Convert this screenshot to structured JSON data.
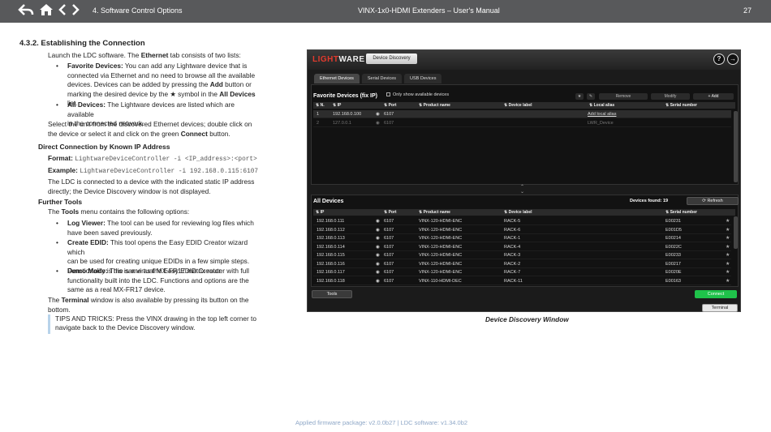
{
  "header": {
    "section": "4. Software Control Options",
    "title": "VINX-1x0-HDMI Extenders – User's Manual",
    "page_number": "27",
    "icons": [
      "back-icon",
      "home-icon",
      "prev-icon",
      "next-icon"
    ]
  },
  "content": {
    "heading": "4.3.2. Establishing the Connection",
    "intro_pre": "Launch the LDC software. The ",
    "intro_bold": "Ethernet",
    "intro_post": " tab consists of two lists:",
    "fav_label": "Favorite Devices:",
    "fav_line1": " You can add any Lightware device that is",
    "fav_line2": "connected via Ethernet and no need to browse all the available",
    "fav_line3_pre": "devices. Devices can be added by pressing the ",
    "fav_line3_bold": "Add",
    "fav_line3_post": " button or",
    "fav_line4_pre": "marking the desired device by the ★ symbol in the ",
    "fav_line4_bold": "All Devices",
    "fav_line4_post": " list.",
    "all_label": "All Devices:",
    "all_line1": " The Lightware devices are listed which are available",
    "all_line2": "in the connected network.",
    "select_line1": "Select the unit from the discovered Ethernet devices; double click on",
    "select_line2_pre": "the device or select it and click on the green ",
    "select_line2_bold": "Connect",
    "select_line2_post": " button.",
    "direct_heading": "Direct Connection by Known IP Address",
    "format_label": "Format:",
    "format_value": "LightwareDeviceController -i <IP_address>:<port>",
    "example_label": "Example:",
    "example_value": "LightwareDeviceController -i 192.168.0.115:6107",
    "ldc_line1": "The LDC is connected to a device with the indicated static IP address",
    "ldc_line2": "directly; the Device Discovery window is not displayed.",
    "further_heading": "Further Tools",
    "tools_pre": "The ",
    "tools_bold": "Tools",
    "tools_post": " menu contains the following options:",
    "log_label": "Log Viewer:",
    "log_line1": " The tool can be used for reviewing log files which",
    "log_line2": "have been saved previously.",
    "edid_label": "Create EDID:",
    "edid_line1": " This tool opens the Easy EDID Creator wizard which",
    "edid_line2": "can be used for creating unique EDIDs in a few simple steps.",
    "edid_line3": "Functionality is the same as the Easy EDID Creator.",
    "demo_label": "Demo Mode:",
    "demo_line1": " This is a virtual MX-FR17 matrix router with full",
    "demo_line2": "functionality built into the LDC. Functions and options are the",
    "demo_line3": "same as a real MX-FR17 device.",
    "term_pre": "The ",
    "term_bold": "Terminal",
    "term_post": " window is also available by pressing its button on the",
    "term_line2": "bottom.",
    "tips_line1": "TIPS AND TRICKS: Press the VINX drawing in the top left corner to",
    "tips_line2": "navigate back to the Device Discovery window."
  },
  "app": {
    "logo_top": "LIGHT",
    "logo_bottom": "WARE",
    "device_discovery_button": "Device Discovery",
    "help_icon": "?",
    "exit_icon": "→",
    "tabs": [
      "Ethernet Devices",
      "Serial Devices",
      "USB Devices"
    ],
    "favorites_title": "Favorite Devices (fix IP)",
    "only_show_available": "Only show available devices",
    "fav_buttons": [
      "Remove",
      "Modify",
      "Add"
    ],
    "fav_columns": [
      "N.",
      "IP",
      "Port",
      "Product name",
      "Device label",
      "Local alias",
      "Serial number"
    ],
    "fav_rows": [
      {
        "n": "1",
        "ip": "192.168.0.100",
        "port": "6107",
        "product": "",
        "label": "",
        "alias": "Add local alias",
        "serial": ""
      },
      {
        "n": "2",
        "ip": "127.0.0.1",
        "port": "6107",
        "product": "",
        "label": "",
        "alias": "LWR_Device",
        "serial": ""
      }
    ],
    "all_title": "All Devices",
    "devices_found": "Devices found: 19",
    "refresh": "Refresh",
    "all_columns": [
      "IP",
      "Port",
      "Product name",
      "Device label",
      "Serial number"
    ],
    "all_rows": [
      {
        "ip": "192.168.0.111",
        "port": "6107",
        "product": "VINX-120-HDMI-ENC",
        "label": "RACK-5",
        "serial": "E00231"
      },
      {
        "ip": "192.168.0.112",
        "port": "6107",
        "product": "VINX-120-HDMI-ENC",
        "label": "RACK-6",
        "serial": "E001D5"
      },
      {
        "ip": "192.168.0.113",
        "port": "6107",
        "product": "VINX-120-HDMI-ENC",
        "label": "RACK-1",
        "serial": "E00214"
      },
      {
        "ip": "192.168.0.114",
        "port": "6107",
        "product": "VINX-120-HDMI-ENC",
        "label": "RACK-4",
        "serial": "E0022C"
      },
      {
        "ip": "192.168.0.115",
        "port": "6107",
        "product": "VINX-120-HDMI-ENC",
        "label": "RACK-3",
        "serial": "E00233"
      },
      {
        "ip": "192.168.0.116",
        "port": "6107",
        "product": "VINX-120-HDMI-ENC",
        "label": "RACK-2",
        "serial": "E00217"
      },
      {
        "ip": "192.168.0.117",
        "port": "6107",
        "product": "VINX-120-HDMI-ENC",
        "label": "RACK-7",
        "serial": "E0020E"
      },
      {
        "ip": "192.168.0.118",
        "port": "6107",
        "product": "VINX-110-HDMI-DEC",
        "label": "RACK-11",
        "serial": "E00163"
      }
    ],
    "tools_button": "Tools",
    "connect_button": "Connect",
    "terminal_button": "Terminal"
  },
  "caption": "Device Discovery Window",
  "footer": "Applied firmware package: v2.0.0b27    |    LDC software: v1.34.0b2"
}
